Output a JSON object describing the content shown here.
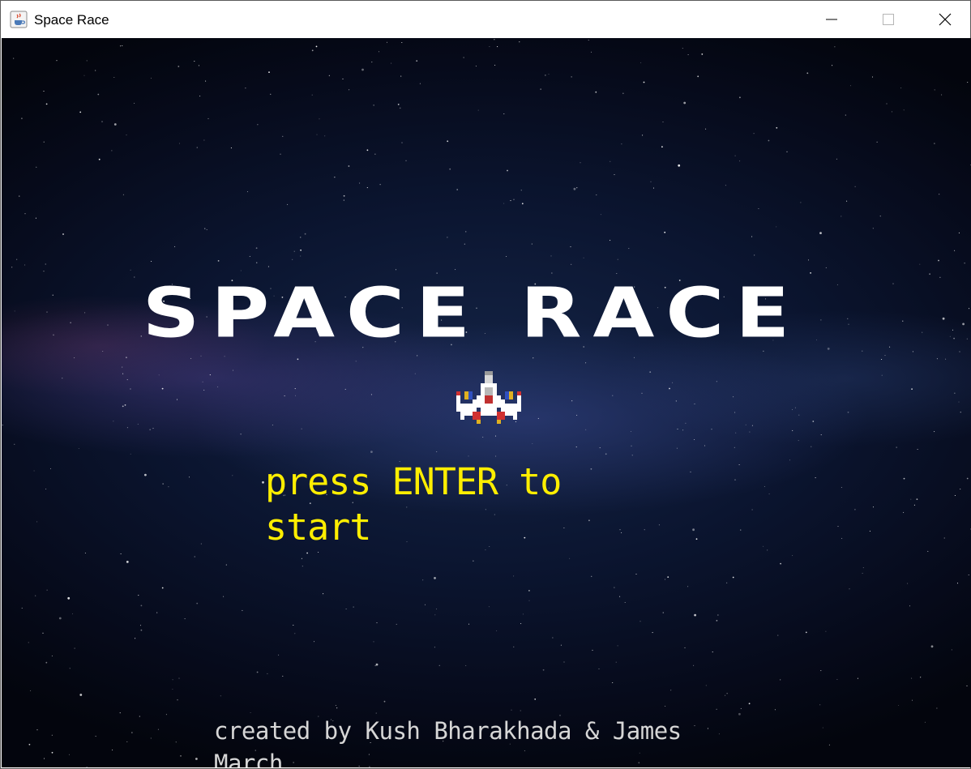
{
  "window": {
    "title": "Space Race",
    "app_icon": "java-cup-icon",
    "controls": {
      "minimize_icon": "minimize-icon",
      "maximize_icon": "maximize-icon",
      "close_icon": "close-icon"
    }
  },
  "game": {
    "title": "SPACE RACE",
    "prompt": "press ENTER to start",
    "credits": "created by Kush Bharakhada & James March",
    "ship_icon": "spaceship-icon",
    "colors": {
      "title": "#ffffff",
      "prompt": "#ffee00",
      "credits": "#d6d6d6",
      "background": "#0b1530"
    }
  }
}
